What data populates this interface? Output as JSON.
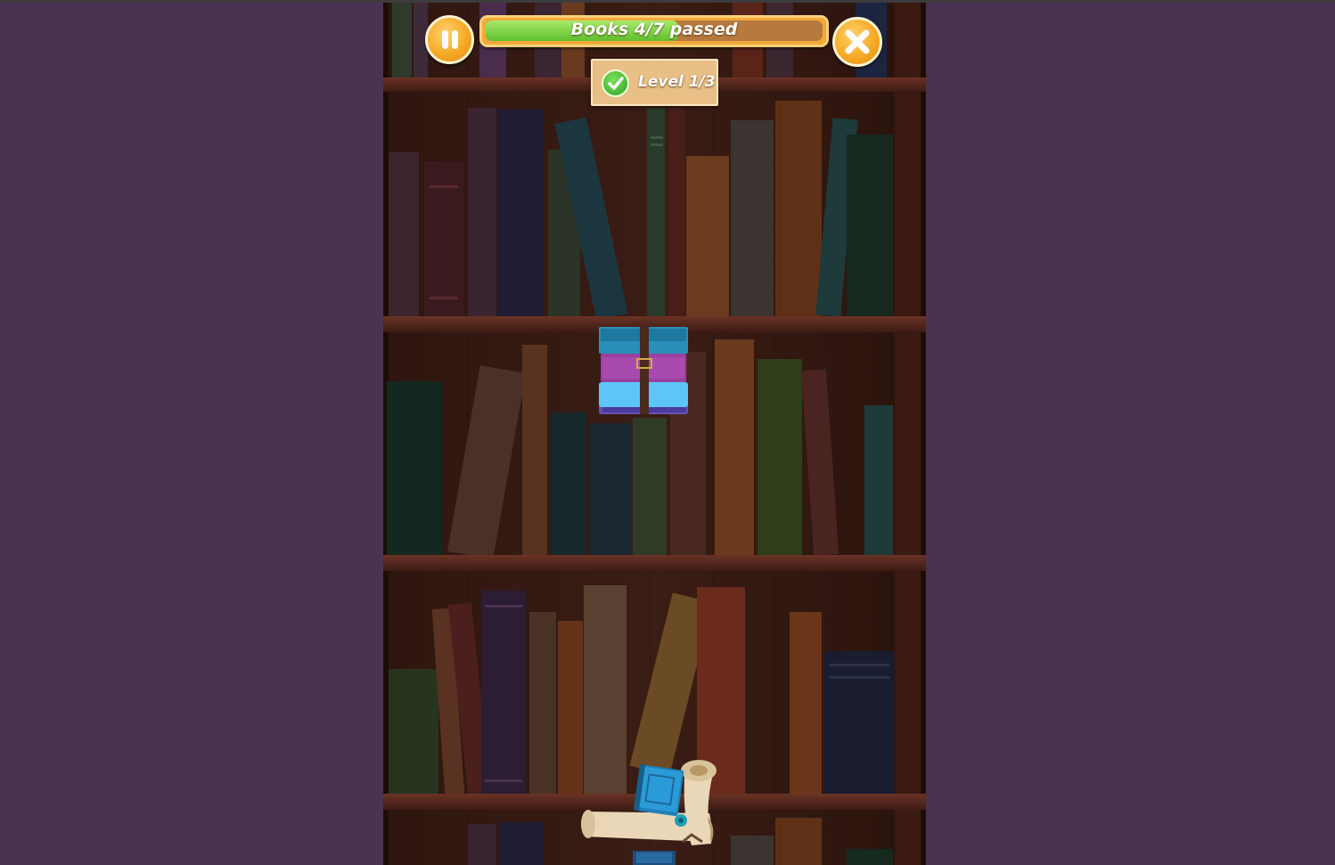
{
  "hud": {
    "pause_icon": "pause-icon",
    "close_icon": "close-icon",
    "progress_text": "Books 4/7 passed",
    "progress_fraction": 0.571,
    "level_text": "Level 1/3",
    "level_icon": "checkmark-icon"
  },
  "colors": {
    "page_background": "#4a3352",
    "button_orange": "#f5a623",
    "progress_green": "#6cc936",
    "badge_tan": "#e8bf86"
  },
  "scene": {
    "falling_book_stack": [
      "teal book",
      "purple book",
      "light blue book"
    ],
    "stacked_items": [
      "blue book",
      "parchment scroll",
      "rolled map"
    ]
  }
}
